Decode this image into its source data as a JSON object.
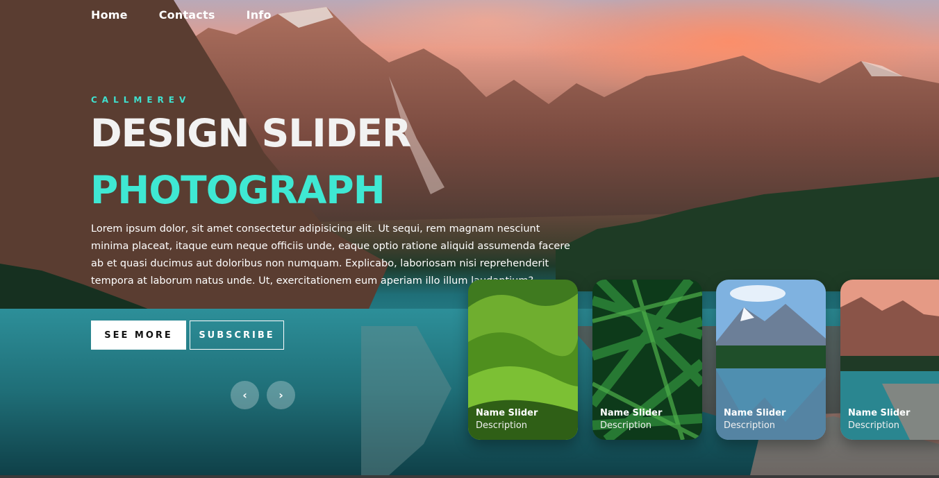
{
  "nav": {
    "items": [
      "Home",
      "Contacts",
      "Info"
    ]
  },
  "hero": {
    "author": "CALLMEREV",
    "title": "DESIGN SLIDER",
    "topic": "PHOTOGRAPH",
    "description": "Lorem ipsum dolor, sit amet consectetur adipisicing elit. Ut sequi, rem magnam nesciunt minima placeat, itaque eum neque officiis unde, eaque optio ratione aliquid assumenda facere ab et quasi ducimus aut doloribus non numquam. Explicabo, laboriosam nisi reprehenderit tempora at laborum natus unde. Ut, exercitationem eum aperiam illo illum laudantium?",
    "buttons": {
      "see_more": "SEE MORE",
      "subscribe": "SUBSCRIBE"
    }
  },
  "arrows": {
    "prev_icon": "chevron-left-icon",
    "next_icon": "chevron-right-icon",
    "prev": "‹",
    "next": "›"
  },
  "thumbnails": [
    {
      "name": "Name Slider",
      "description": "Description",
      "scene": "green-hills"
    },
    {
      "name": "Name Slider",
      "description": "Description",
      "scene": "fern-leaves"
    },
    {
      "name": "Name Slider",
      "description": "Description",
      "scene": "mountain-lake"
    },
    {
      "name": "Name Slider",
      "description": "Description",
      "scene": "sunset-mountains"
    }
  ],
  "colors": {
    "accent": "#3fe8d3",
    "text": "#ffffff"
  }
}
